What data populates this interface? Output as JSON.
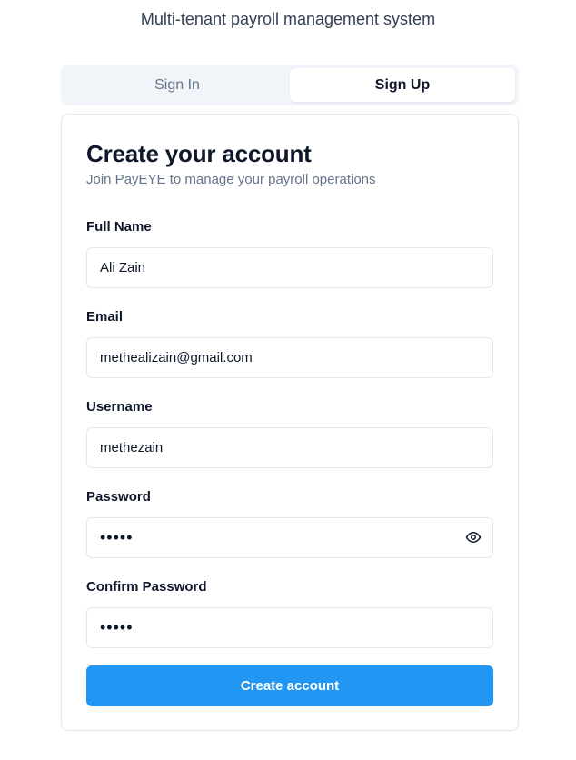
{
  "header": {
    "tagline": "Multi-tenant payroll management system"
  },
  "tabs": [
    {
      "label": "Sign In",
      "active": false
    },
    {
      "label": "Sign Up",
      "active": true
    }
  ],
  "form": {
    "title": "Create your account",
    "subtitle": "Join PayEYE to manage your payroll operations",
    "full_name": {
      "label": "Full Name",
      "value": "Ali Zain"
    },
    "email": {
      "label": "Email",
      "value": "methealizain@gmail.com"
    },
    "username": {
      "label": "Username",
      "value": "methezain"
    },
    "password": {
      "label": "Password",
      "value": "•••••",
      "toggle_icon": "eye-icon"
    },
    "confirm_password": {
      "label": "Confirm Password",
      "value": "•••••"
    },
    "submit_label": "Create account"
  },
  "colors": {
    "primary": "#2196f3",
    "border": "#e2e8f0",
    "muted_text": "#64748b",
    "tab_background": "#f1f5f9"
  }
}
